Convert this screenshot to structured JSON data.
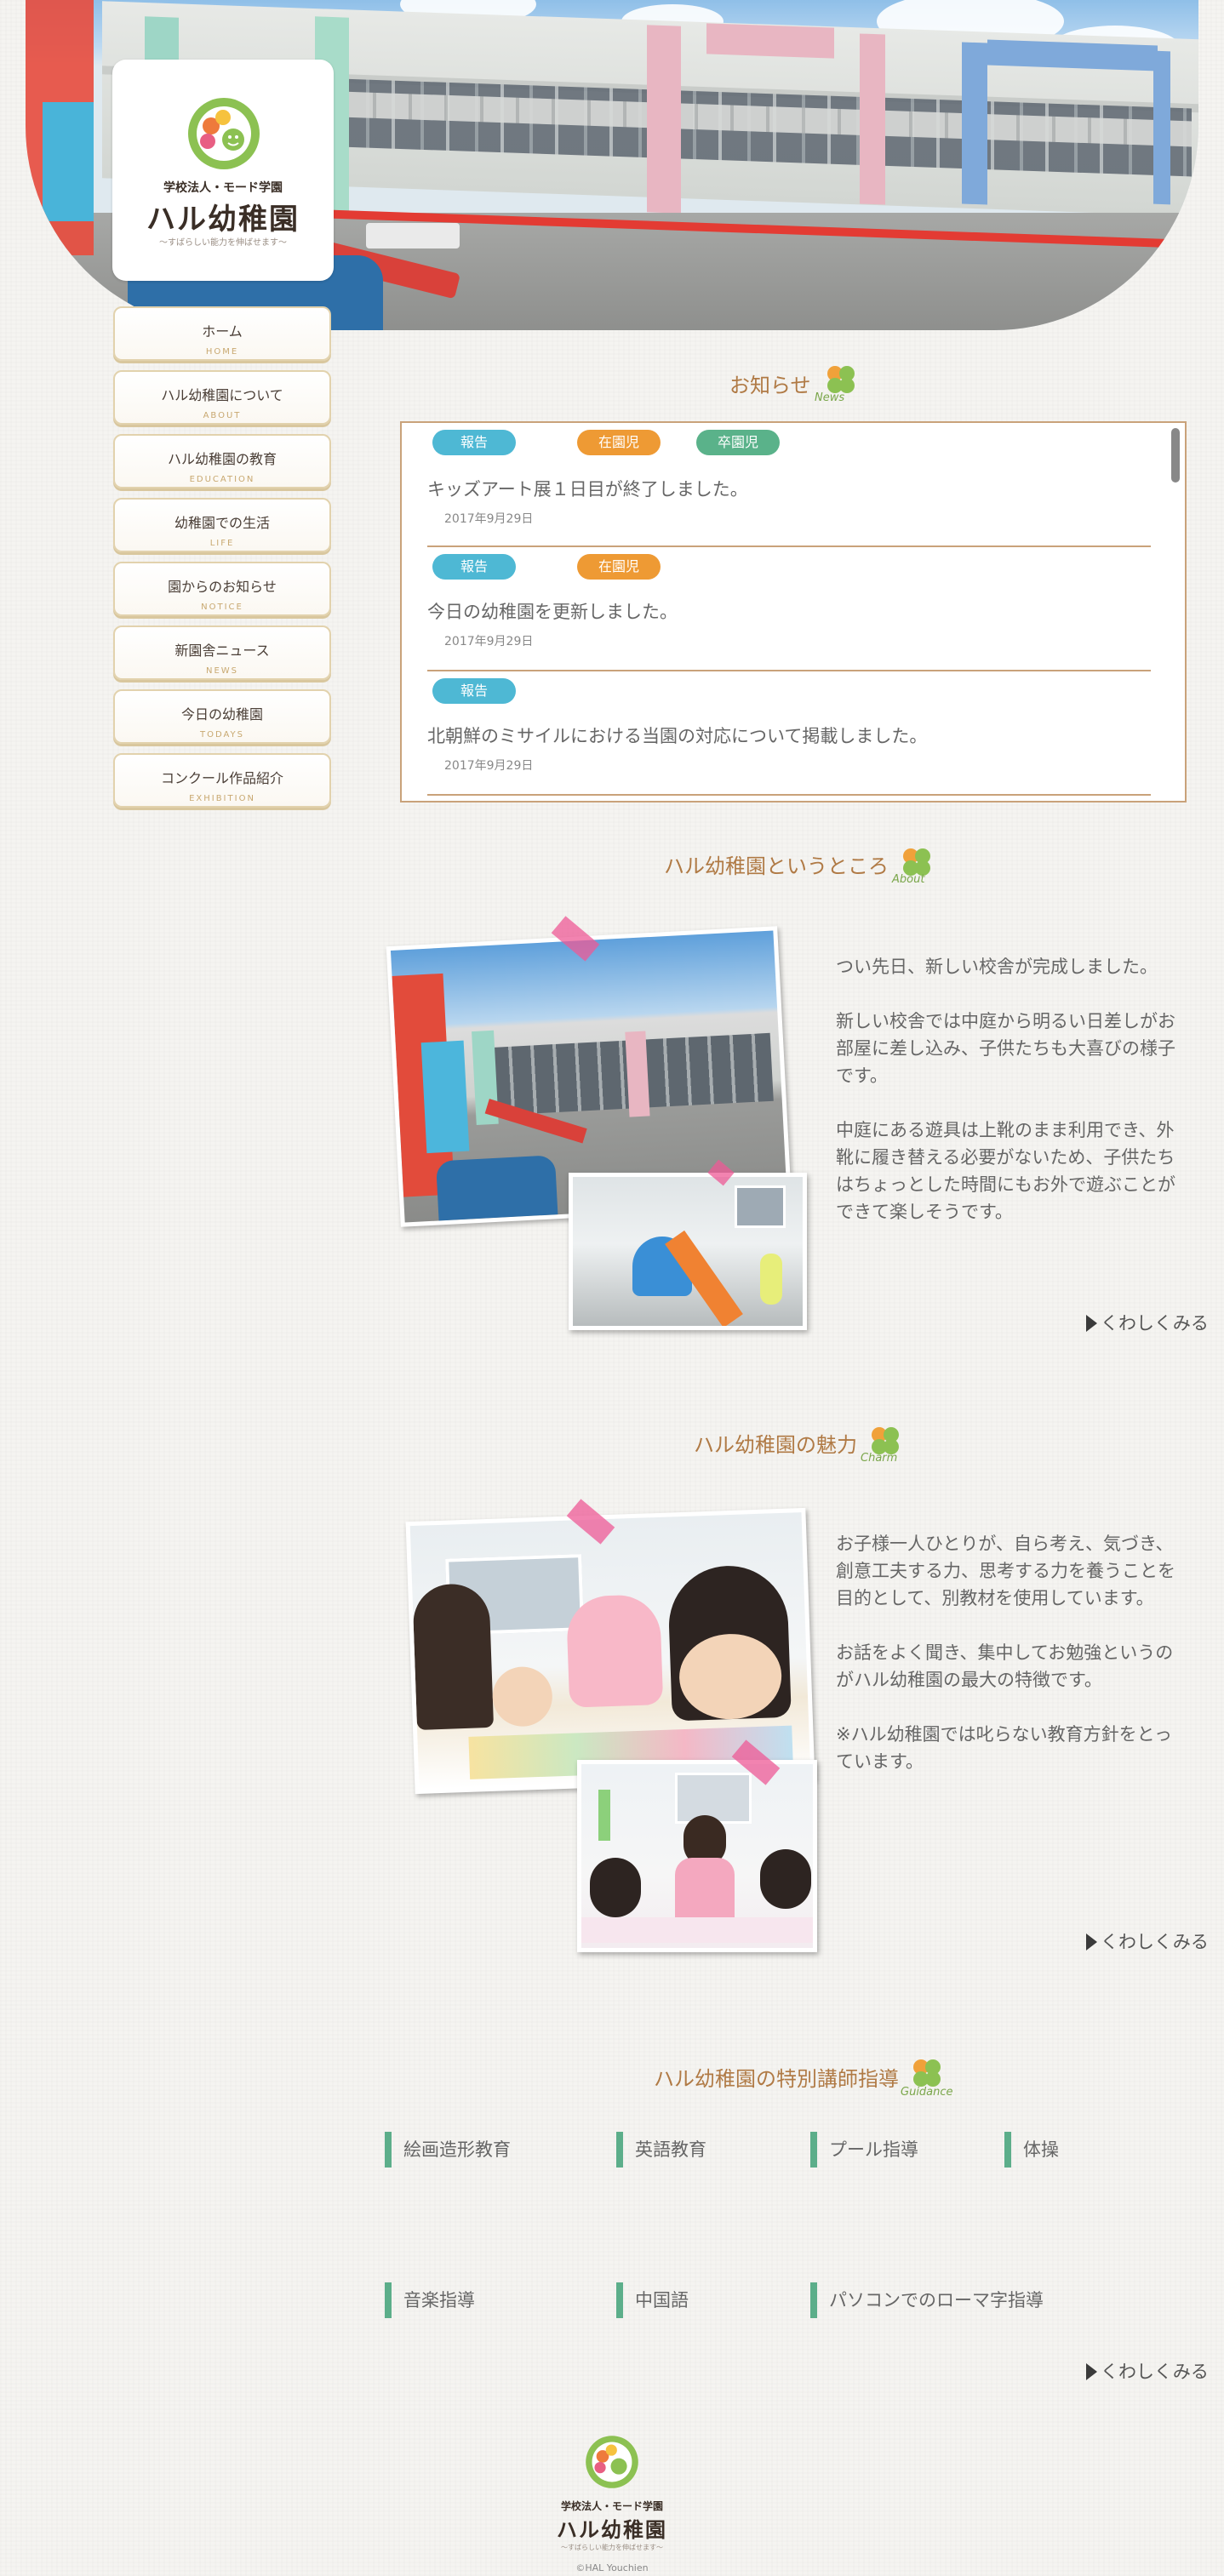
{
  "logo": {
    "sub": "学校法人・モード学園",
    "name": "ハル幼稚園",
    "tagline": "～すばらしい能力を伸ばせます～"
  },
  "nav": [
    {
      "jp": "ホーム",
      "en": "HOME"
    },
    {
      "jp": "ハル幼稚園について",
      "en": "ABOUT"
    },
    {
      "jp": "ハル幼稚園の教育",
      "en": "EDUCATION"
    },
    {
      "jp": "幼稚園での生活",
      "en": "LIFE"
    },
    {
      "jp": "園からのお知らせ",
      "en": "NOTICE"
    },
    {
      "jp": "新園舎ニュース",
      "en": "NEWS"
    },
    {
      "jp": "今日の幼稚園",
      "en": "TODAYS"
    },
    {
      "jp": "コンクール作品紹介",
      "en": "EXHIBITION"
    }
  ],
  "news": {
    "title": "お知らせ",
    "en": "News",
    "items": [
      {
        "tags": [
          "報告",
          "在園児",
          "卒園児"
        ],
        "title": "キッズアート展１日目が終了しました。",
        "date": "2017年9月29日"
      },
      {
        "tags": [
          "報告",
          "在園児"
        ],
        "title": "今日の幼稚園を更新しました。",
        "date": "2017年9月29日"
      },
      {
        "tags": [
          "報告"
        ],
        "title": "北朝鮮のミサイルにおける当園の対応について掲載しました。",
        "date": "2017年9月29日"
      }
    ]
  },
  "about": {
    "title": "ハル幼稚園というところ",
    "en": "About",
    "p1": "つい先日、新しい校舎が完成しました。",
    "p2": "新しい校舎では中庭から明るい日差しがお部屋に差し込み、子供たちも大喜びの様子です。",
    "p3": "中庭にある遊具は上靴のまま利用でき、外靴に履き替える必要がないため、子供たちはちょっとした時間にもお外で遊ぶことができて楽しそうです。",
    "more": "くわしくみる"
  },
  "charm": {
    "title": "ハル幼稚園の魅力",
    "en": "Charm",
    "p1": "お子様一人ひとりが、自ら考え、気づき、創意工夫する力、思考する力を養うことを目的として、別教材を使用しています。",
    "p2": "お話をよく聞き、集中してお勉強というのがハル幼稚園の最大の特徴です。",
    "p3": "※ハル幼稚園では叱らない教育方針をとっています。",
    "more": "くわしくみる"
  },
  "guidance": {
    "title": "ハル幼稚園の特別講師指導",
    "en": "Guidance",
    "items": [
      "絵画造形教育",
      "英語教育",
      "プール指導",
      "体操",
      "音楽指導",
      "中国語",
      "パソコンでのローマ字指導"
    ],
    "more": "くわしくみる"
  },
  "footer": {
    "sub": "学校法人・モード学園",
    "name": "ハル幼稚園",
    "tagline": "～すばらしい能力を伸ばせます～",
    "copy": "©HAL Youchien"
  },
  "colors": {
    "accent_title": "#b07a45",
    "tag_blue": "#4eb8d4",
    "tag_orange": "#ee9a34",
    "tag_green": "#5ab28a",
    "clover_green": "#7aa64a",
    "guidance_bar": "#5cae8a"
  }
}
